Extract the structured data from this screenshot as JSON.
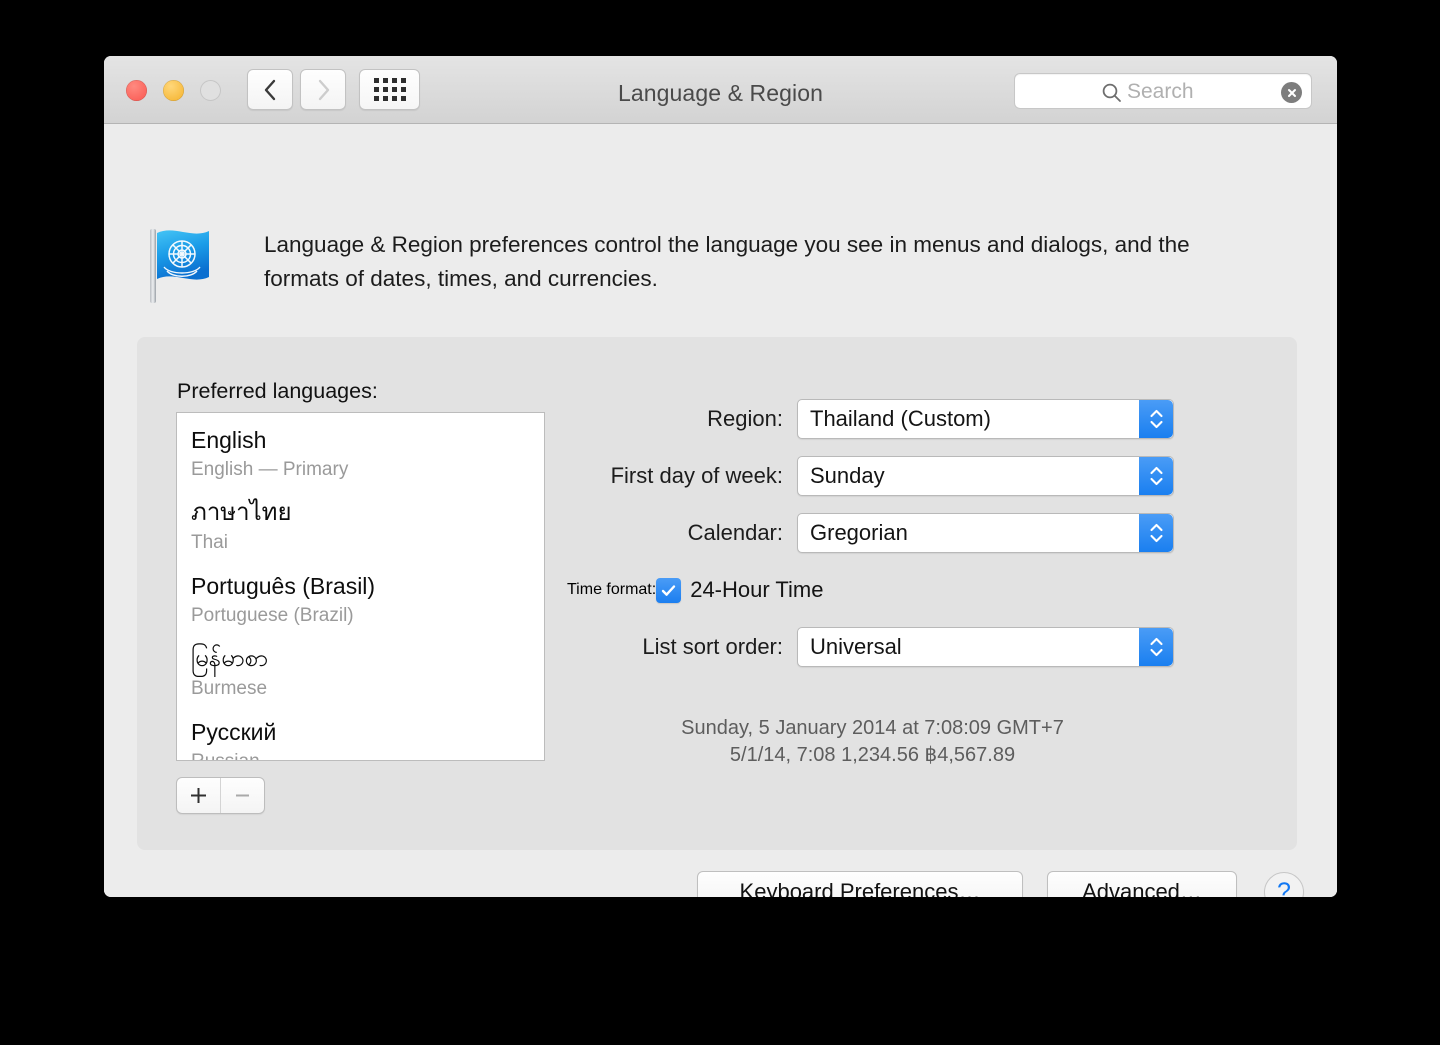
{
  "window": {
    "title": "Language & Region",
    "traffic_lights": [
      "close-button",
      "minimize-button",
      "zoom-button"
    ],
    "nav": {
      "back_icon": "chevron-left-icon",
      "forward_icon": "chevron-right-icon",
      "grid_icon": "show-all-grid-icon"
    },
    "search": {
      "placeholder": "Search",
      "value": "",
      "icon": "search-icon",
      "clear_icon": "clear-circle-icon"
    }
  },
  "header": {
    "icon": "un-flag-icon",
    "description": "Language & Region preferences control the language you see in menus and dialogs, and the formats of dates, times, and currencies."
  },
  "panel": {
    "preferred_languages_label": "Preferred languages:",
    "languages": [
      {
        "native": "English",
        "sub": "English — Primary"
      },
      {
        "native": "ภาษาไทย",
        "sub": "Thai"
      },
      {
        "native": "Português (Brasil)",
        "sub": "Portuguese (Brazil)"
      },
      {
        "native": "မြန်မာစာ",
        "sub": "Burmese"
      },
      {
        "native": "Русский",
        "sub": "Russian"
      }
    ],
    "add_button_label": "+",
    "remove_button_label": "−",
    "fields": [
      {
        "label": "Region:",
        "value": "Thailand (Custom)"
      },
      {
        "label": "First day of week:",
        "value": "Sunday"
      },
      {
        "label": "Calendar:",
        "value": "Gregorian"
      }
    ],
    "time_format": {
      "label": "Time format:",
      "checkbox_label": "24-Hour Time",
      "checked": true
    },
    "sort_order": {
      "label": "List sort order:",
      "value": "Universal"
    },
    "sample": {
      "line1": "Sunday, 5 January 2014 at 7:08:09 GMT+7",
      "line2": "5/1/14, 7:08    1,234.56    ฿4,567.89"
    }
  },
  "footer": {
    "keyboard_preferences_label": "Keyboard Preferences…",
    "advanced_label": "Advanced…",
    "help_label": "?"
  },
  "colors": {
    "accent_blue": "#1a7ff0",
    "window_bg": "#ececec",
    "panel_bg": "#e2e2e2",
    "close_red": "#f9564f",
    "minimize_yellow": "#f4b12a"
  }
}
